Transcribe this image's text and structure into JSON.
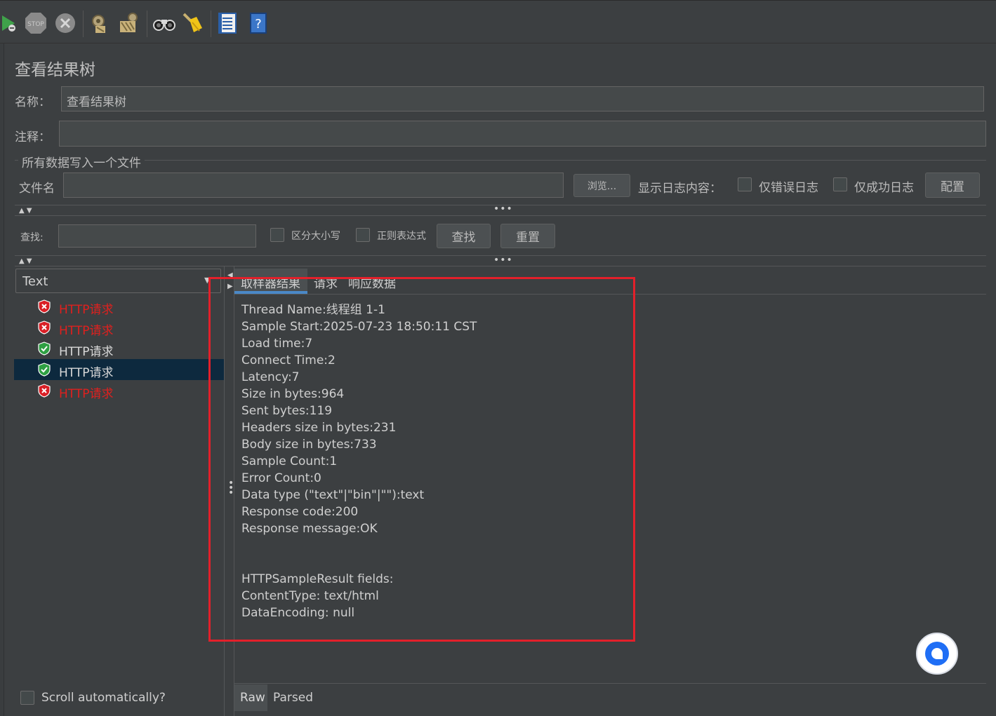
{
  "toolbar": {
    "icons": [
      "start-no-pauses-icon",
      "stop-icon",
      "shutdown-icon",
      "clear-icon",
      "clear-all-icon",
      "search-icon",
      "reset-search-icon",
      "function-helper-icon",
      "help-icon"
    ],
    "stop_text": "STOP"
  },
  "panel": {
    "title": "查看结果树",
    "name_label": "名称：",
    "name_value": "查看结果树",
    "comment_label": "注释：",
    "comment_value": "",
    "file_group_label": "所有数据写入一个文件",
    "filename_label": "文件名",
    "filename_value": "",
    "browse_label": "浏览...",
    "log_content_label": "显示日志内容：",
    "errors_only_label": "仅错误日志",
    "success_only_label": "仅成功日志",
    "configure_label": "配置"
  },
  "search": {
    "label": "查找:",
    "value": "",
    "case_sensitive_label": "区分大小写",
    "regex_label": "正则表达式",
    "find_label": "查找",
    "reset_label": "重置"
  },
  "renderer": {
    "selected": "Text"
  },
  "tree": {
    "items": [
      {
        "label": "HTTP请求",
        "status": "error"
      },
      {
        "label": "HTTP请求",
        "status": "error"
      },
      {
        "label": "HTTP请求",
        "status": "success"
      },
      {
        "label": "HTTP请求",
        "status": "success",
        "selected": true
      },
      {
        "label": "HTTP请求",
        "status": "error"
      }
    ],
    "item_0": "HTTP请求",
    "item_1": "HTTP请求",
    "item_2": "HTTP请求",
    "item_3": "HTTP请求",
    "item_4": "HTTP请求"
  },
  "scroll_auto_label": "Scroll automatically?",
  "tabs": {
    "sampler_result": "取样器结果",
    "request": "请求",
    "response_data": "响应数据",
    "active": "取样器结果"
  },
  "detail": {
    "lines": [
      "Thread Name:线程组 1-1",
      "Sample Start:2025-07-23 18:50:11 CST",
      "Load time:7",
      "Connect Time:2",
      "Latency:7",
      "Size in bytes:964",
      "Sent bytes:119",
      "Headers size in bytes:231",
      "Body size in bytes:733",
      "Sample Count:1",
      "Error Count:0",
      "Data type (\"text\"|\"bin\"|\"\"):text",
      "Response code:200",
      "Response message:OK",
      "",
      "",
      "HTTPSampleResult fields:",
      "ContentType: text/html",
      "DataEncoding: null"
    ],
    "line_0": "Thread Name:线程组 1-1",
    "line_1": "Sample Start:2025-07-23 18:50:11 CST",
    "line_2": "Load time:7",
    "line_3": "Connect Time:2",
    "line_4": "Latency:7",
    "line_5": "Size in bytes:964",
    "line_6": "Sent bytes:119",
    "line_7": "Headers size in bytes:231",
    "line_8": "Body size in bytes:733",
    "line_9": "Sample Count:1",
    "line_10": "Error Count:0",
    "line_11": "Data type (\"text\"|\"bin\"|\"\"):text",
    "line_12": "Response code:200",
    "line_13": "Response message:OK",
    "line_14": "HTTPSampleResult fields:",
    "line_15": "ContentType: text/html",
    "line_16": "DataEncoding: null"
  },
  "bottom_tabs": {
    "raw": "Raw",
    "parsed": "Parsed",
    "active": "Raw"
  },
  "highlight_color": "#e3202a",
  "error_color": "#e0201e",
  "selection_color": "#0d293e",
  "tab_underline_color": "#4a88c7"
}
